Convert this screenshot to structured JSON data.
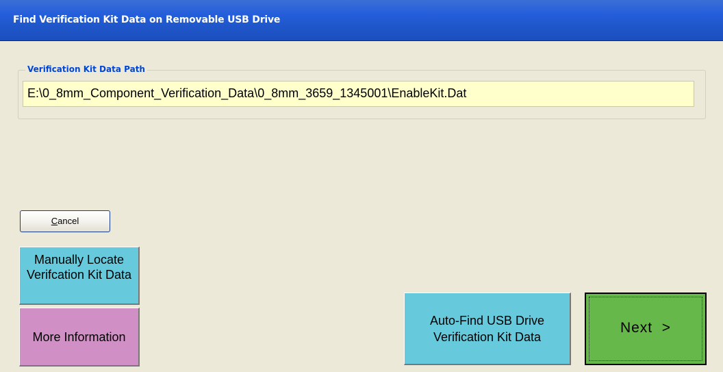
{
  "window": {
    "title": "Find Verification Kit Data on Removable USB Drive"
  },
  "group": {
    "label": "Verification Kit Data Path",
    "path_value": "E:\\0_8mm_Component_Verification_Data\\0_8mm_3659_1345001\\EnableKit.Dat"
  },
  "buttons": {
    "cancel_prefix": "C",
    "cancel_rest": "ancel",
    "manual_locate": "Manually Locate Verifcation Kit Data",
    "more_info": "More Information",
    "auto_find": "Auto-Find USB Drive Verification Kit Data",
    "next": "Next  >"
  },
  "colors": {
    "titlebar": "#245edb",
    "path_field": "#ffffcc",
    "cyan_button": "#67c9dc",
    "pink_button": "#d08fc5",
    "next_button": "#66b84a",
    "legend_text": "#0046d5"
  }
}
